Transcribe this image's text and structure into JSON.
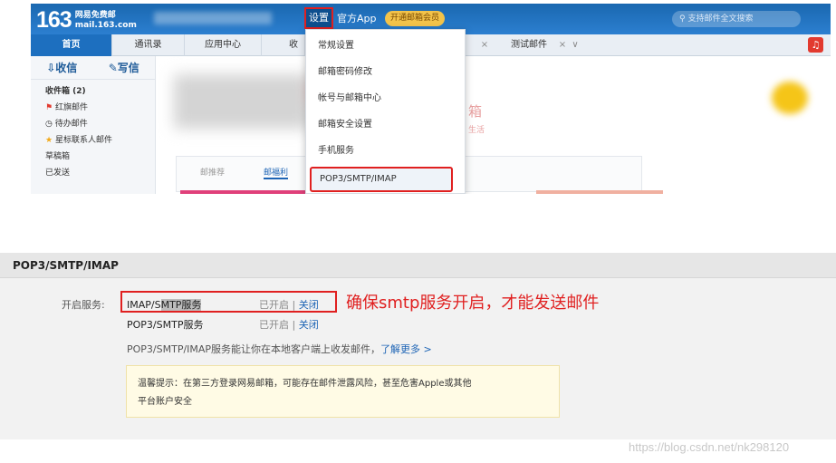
{
  "header": {
    "logo_number": "163",
    "logo_line1": "网易免费邮",
    "logo_line2": "mail.163.com",
    "settings_label": "设置",
    "official_app_label": "官方App",
    "vip_label": "开通邮箱会员",
    "search_placeholder": "支持邮件全文搜索"
  },
  "tabs": {
    "home": "首页",
    "contacts": "通讯录",
    "apps": "应用中心",
    "inbox_partial": "收件",
    "close": "×",
    "test_mail": "测试邮件",
    "more": "∨"
  },
  "sidebar": {
    "receive": "收信",
    "compose": "写信",
    "items": [
      "收件箱 (2)",
      "红旗邮件",
      "待办邮件",
      "星标联系人邮件",
      "草稿箱",
      "已发送"
    ]
  },
  "main": {
    "tab1": "邮推荐",
    "tab2": "邮福利",
    "partial_text1": "箱",
    "partial_text2": "生活"
  },
  "dropdown": {
    "items": [
      "常规设置",
      "邮箱密码修改",
      "帐号与邮箱中心",
      "邮箱安全设置",
      "手机服务",
      "POP3/SMTP/IMAP"
    ]
  },
  "settings_panel": {
    "title": "POP3/SMTP/IMAP",
    "enable_label": "开启服务:",
    "services": [
      {
        "name_a": "IMAP/S",
        "name_b": "MTP服务",
        "state": "已开启",
        "sep": "|",
        "action": "关闭"
      },
      {
        "name": "POP3/SMTP服务",
        "state": "已开启",
        "sep": "|",
        "action": "关闭"
      }
    ],
    "annotation": "确保smtp服务开启，才能发送邮件",
    "description": "POP3/SMTP/IMAP服务能让你在本地客户端上收发邮件，",
    "learn_more": "了解更多 >",
    "tip_line1": "温馨提示：在第三方登录网易邮箱，可能存在邮件泄露风险，甚至危害Apple或其他",
    "tip_line2": "平台账户安全"
  },
  "watermark": "https://blog.csdn.net/nk298120",
  "colors": {
    "header_blue": "#2c7fd0",
    "highlight_red": "#e02020",
    "link_blue": "#1d64b5"
  }
}
